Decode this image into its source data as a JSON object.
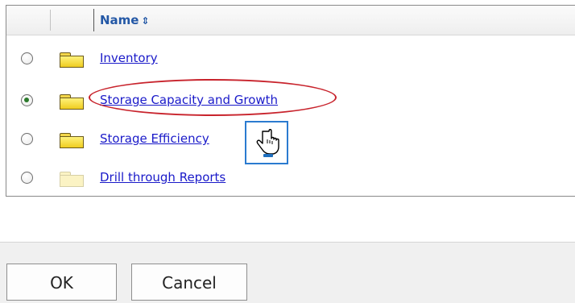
{
  "table": {
    "name_header": "Name",
    "rows": [
      {
        "label": "Inventory",
        "selected": false,
        "folder": "normal"
      },
      {
        "label": "Storage Capacity and Growth",
        "selected": true,
        "folder": "normal"
      },
      {
        "label": "Storage Efficiency",
        "selected": false,
        "folder": "normal"
      },
      {
        "label": "Drill through Reports",
        "selected": false,
        "folder": "faded"
      }
    ]
  },
  "footer": {
    "ok_label": "OK",
    "cancel_label": "Cancel"
  },
  "icons": {
    "sort": "sort-up-down-icon",
    "cursor": "hand-pointer-icon"
  },
  "colors": {
    "link": "#1a1ac9",
    "header_text": "#2458a6",
    "highlight": "#c8232c",
    "cursor_box": "#2b7bd0"
  }
}
